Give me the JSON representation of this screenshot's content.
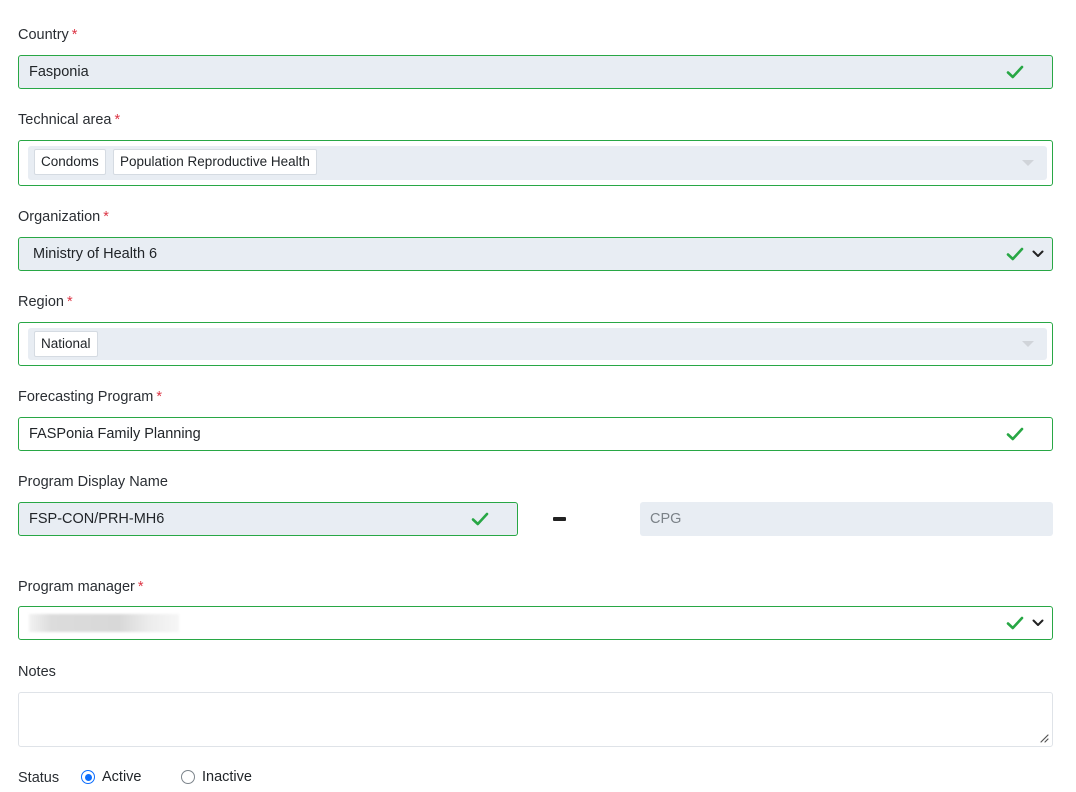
{
  "country": {
    "label": "Country",
    "required_mark": "*",
    "value": "Fasponia"
  },
  "technical_area": {
    "label": "Technical area",
    "required_mark": "*",
    "tags": [
      "Condoms",
      "Population Reproductive Health"
    ]
  },
  "organization": {
    "label": "Organization",
    "required_mark": "*",
    "value": "Ministry of Health 6"
  },
  "region": {
    "label": "Region",
    "required_mark": "*",
    "tags": [
      "National"
    ]
  },
  "forecasting_program": {
    "label": "Forecasting Program",
    "required_mark": "*",
    "value": "FASPonia Family Planning"
  },
  "program_display_name": {
    "label": "Program Display Name",
    "value": "FSP-CON/PRH-MH6",
    "suffix_placeholder": "CPG"
  },
  "program_manager": {
    "label": "Program manager",
    "required_mark": "*"
  },
  "notes": {
    "label": "Notes",
    "value": ""
  },
  "status": {
    "label": "Status",
    "options": [
      "Active",
      "Inactive"
    ],
    "selected": "Active"
  },
  "colors": {
    "valid": "#28a745",
    "required": "#dc3545",
    "accent": "#0d6efd",
    "field_bg": "#e8edf3"
  },
  "icons": {
    "valid": "check-icon",
    "dropdown": "chevron-down-icon",
    "multiselect": "caret-down-icon",
    "textarea": "resize-grip-icon"
  }
}
